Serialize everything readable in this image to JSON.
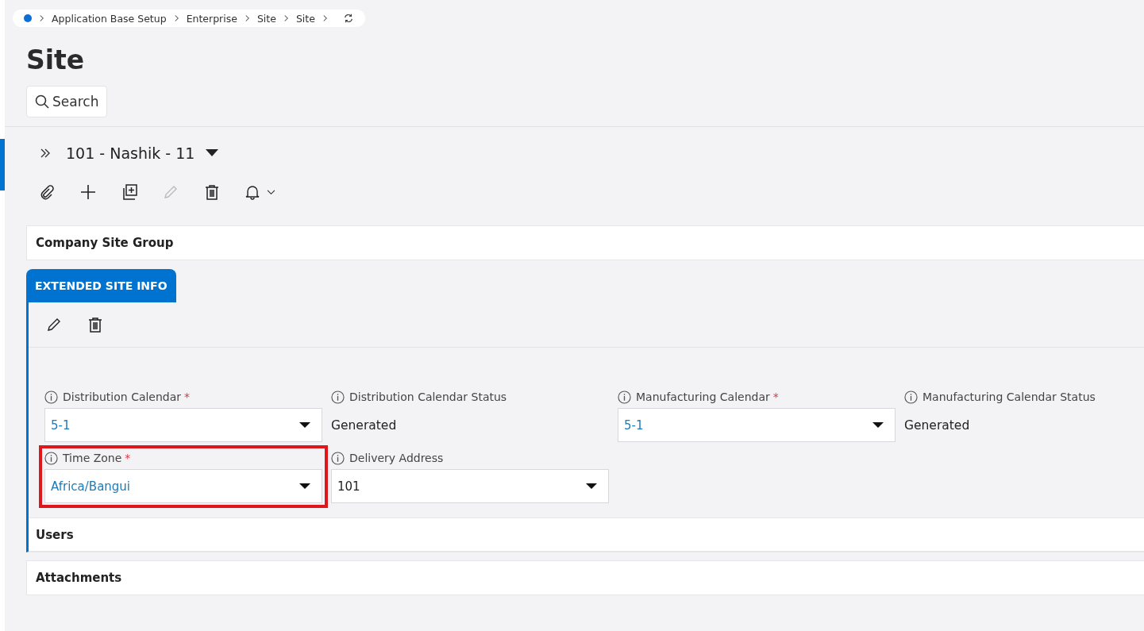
{
  "breadcrumb": {
    "items": [
      "Application Base Setup",
      "Enterprise",
      "Site",
      "Site"
    ]
  },
  "page_title": "Site",
  "search_button": "Search",
  "record": {
    "title": "101 - Nashik - 11"
  },
  "toolbar": [
    {
      "kind": "attach",
      "disabled": false
    },
    {
      "kind": "add",
      "disabled": false
    },
    {
      "kind": "duplicate",
      "disabled": false
    },
    {
      "kind": "edit",
      "disabled": true
    },
    {
      "kind": "delete",
      "disabled": false
    },
    {
      "kind": "notify",
      "disabled": false
    }
  ],
  "group_panel": {
    "title": "Company Site Group"
  },
  "tab": {
    "label": "EXTENDED SITE INFO",
    "selected": true
  },
  "tab_toolbar": [
    {
      "kind": "edit",
      "disabled": false
    },
    {
      "kind": "delete",
      "disabled": false
    }
  ],
  "fields": [
    {
      "kind": "select",
      "label": "Distribution Calendar",
      "required_mark": "*",
      "value": "5-1",
      "link": true,
      "highlighted": false
    },
    {
      "kind": "readonly",
      "label": "Distribution Calendar Status",
      "value": "Generated",
      "link": false,
      "highlighted": false
    },
    {
      "kind": "select",
      "label": "Manufacturing Calendar",
      "required_mark": "*",
      "value": "5-1",
      "link": true,
      "highlighted": false
    },
    {
      "kind": "readonly",
      "label": "Manufacturing Calendar Status",
      "value": "Generated",
      "link": false,
      "highlighted": false
    },
    {
      "kind": "select",
      "label": "Time Zone",
      "required_mark": "*",
      "value": "Africa/Bangui",
      "link": true,
      "highlighted": true
    },
    {
      "kind": "select",
      "label": "Delivery Address",
      "value": "101",
      "link": false,
      "highlighted": false
    }
  ],
  "sub_panels": [
    {
      "title": "Users"
    }
  ],
  "bottom_panels": [
    {
      "title": "Attachments"
    }
  ]
}
